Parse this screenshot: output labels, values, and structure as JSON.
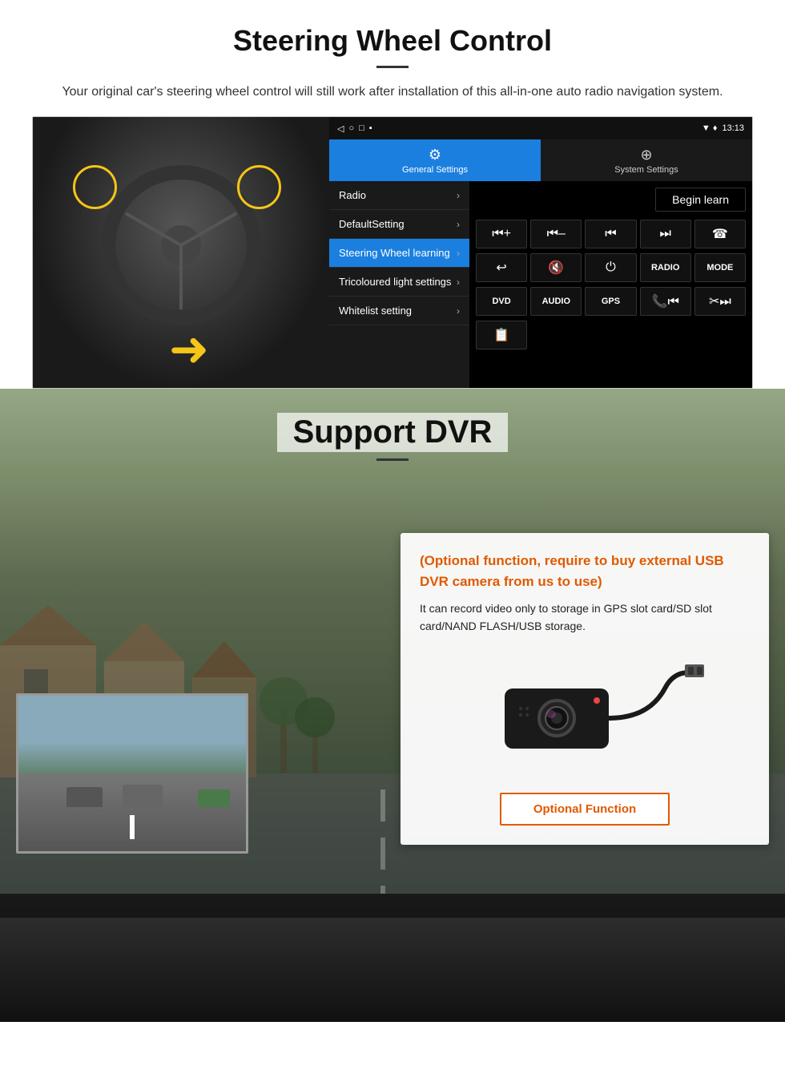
{
  "steering": {
    "title": "Steering Wheel Control",
    "description": "Your original car's steering wheel control will still work after installation of this all-in-one auto radio navigation system.",
    "android_ui": {
      "status_time": "13:13",
      "status_icons": "▼ ♦",
      "tab_general": "General Settings",
      "tab_system": "System Settings",
      "menu_items": [
        {
          "label": "Radio",
          "active": false
        },
        {
          "label": "DefaultSetting",
          "active": false
        },
        {
          "label": "Steering Wheel learning",
          "active": true
        },
        {
          "label": "Tricoloured light settings",
          "active": false
        },
        {
          "label": "Whitelist setting",
          "active": false
        }
      ],
      "begin_learn": "Begin learn",
      "control_buttons": [
        "⏮+",
        "⏮–",
        "⏮",
        "⏭",
        "☎",
        "↩",
        "🔇",
        "⏻",
        "RADIO",
        "MODE",
        "DVD",
        "AUDIO",
        "GPS",
        "📞⏮",
        "✂⏭",
        "📋"
      ]
    }
  },
  "dvr": {
    "title": "Support DVR",
    "card": {
      "title": "(Optional function, require to buy external USB DVR camera from us to use)",
      "description": "It can record video only to storage in GPS slot card/SD slot card/NAND FLASH/USB storage.",
      "optional_button_label": "Optional Function"
    }
  }
}
